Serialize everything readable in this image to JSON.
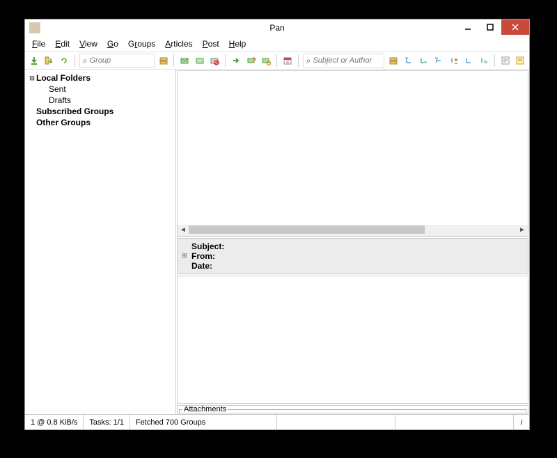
{
  "window": {
    "title": "Pan"
  },
  "menu": {
    "file": "File",
    "edit": "Edit",
    "view": "View",
    "go": "Go",
    "groups": "Groups",
    "articles": "Articles",
    "post": "Post",
    "help": "Help"
  },
  "toolbar": {
    "group_search_placeholder": "Group",
    "subject_search_placeholder": "Subject or Author"
  },
  "tree": {
    "local_folders": "Local Folders",
    "sent": "Sent",
    "drafts": "Drafts",
    "subscribed": "Subscribed Groups",
    "other": "Other Groups"
  },
  "headers": {
    "subject": "Subject:",
    "from": "From:",
    "date": "Date:"
  },
  "attachments": {
    "label": "Attachments"
  },
  "status": {
    "speed": "1 @ 0.8 KiB/s",
    "tasks": "Tasks: 1/1",
    "message": "Fetched 700 Groups"
  }
}
